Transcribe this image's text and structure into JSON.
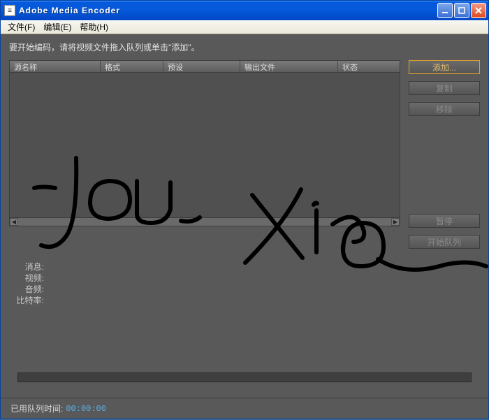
{
  "title": "Adobe Media Encoder",
  "menu": {
    "file": "文件(F)",
    "edit": "编辑(E)",
    "help": "帮助(H)"
  },
  "instruction": "要开始编码，请将视频文件拖入队列或单击\"添加\"。",
  "columns": {
    "source": "源名称",
    "format": "格式",
    "preset": "预设",
    "output": "输出文件",
    "status": "状态"
  },
  "buttons": {
    "add": "添加...",
    "duplicate": "复制",
    "remove": "移除",
    "pause": "暂停",
    "start": "开始队列"
  },
  "info": {
    "message": "消息:",
    "video": "视频:",
    "audio": "音频:",
    "bitrate": "比特率:"
  },
  "status": {
    "label": "已用队列时间:",
    "time": "00:00:00"
  }
}
